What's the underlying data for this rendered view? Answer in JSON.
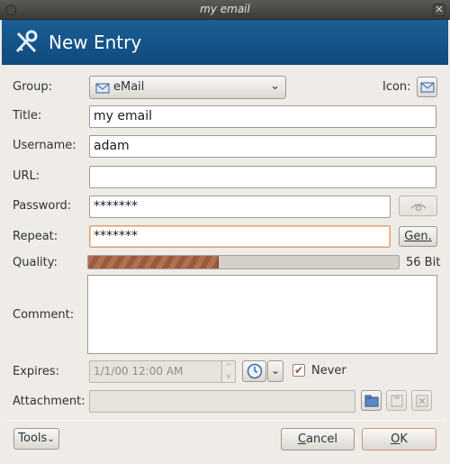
{
  "window": {
    "title": "my email"
  },
  "banner": {
    "title": "New Entry",
    "icon": "keys-tools-icon"
  },
  "group": {
    "label": "Group:",
    "value": "eMail"
  },
  "icon_field": {
    "label": "Icon:"
  },
  "title_field": {
    "label": "Title:",
    "value": "my email"
  },
  "username": {
    "label": "Username:",
    "value": "adam"
  },
  "url": {
    "label": "URL:",
    "value": ""
  },
  "password": {
    "label": "Password:",
    "value": "*******"
  },
  "repeat": {
    "label": "Repeat:",
    "value": "*******",
    "gen_label": "Gen."
  },
  "quality": {
    "label": "Quality:",
    "value_text": "56 Bit",
    "fill_fraction": 0.42
  },
  "comment": {
    "label": "Comment:",
    "value": ""
  },
  "expires": {
    "label": "Expires:",
    "value": "1/1/00 12:00 AM",
    "never_label": "Never",
    "never_checked": true
  },
  "attachment": {
    "label": "Attachment:",
    "value": ""
  },
  "footer": {
    "tools_label": "Tools",
    "cancel_label": "Cancel",
    "ok_label": "OK"
  },
  "colors": {
    "banner": "#1c5e95",
    "quality_fill": "#9a5a40",
    "focus_border": "#d9a57f"
  }
}
